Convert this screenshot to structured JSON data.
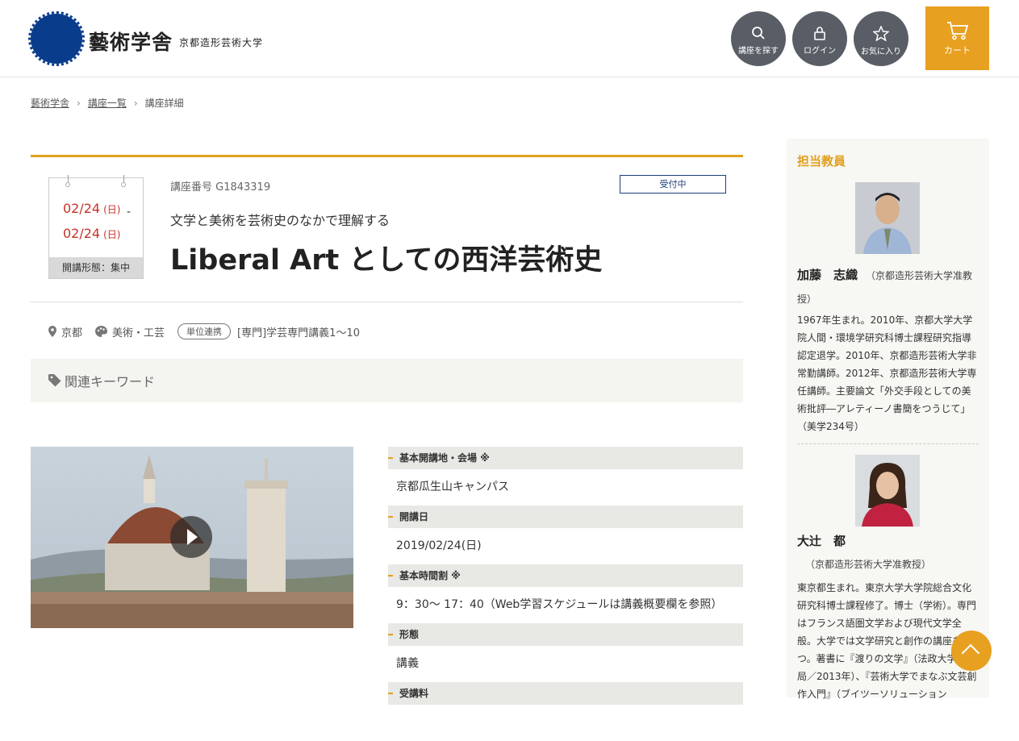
{
  "header": {
    "logo_text": "藝術学舎",
    "logo_sub": "京都造形芸術大学",
    "search_label": "講座を探す",
    "login_label": "ログイン",
    "favorites_label": "お気に入り",
    "cart_label": "カート"
  },
  "breadcrumb": [
    "藝術学舎",
    "講座一覧",
    "講座詳細"
  ],
  "course": {
    "date_start": "02/24",
    "date_start_day": "(日)",
    "date_end": "02/24",
    "date_end_day": "(日)",
    "format": "開講形態：集中",
    "number": "講座番号 G1843319",
    "status": "受付中",
    "subtitle": "文学と美術を芸術史のなかで理解する",
    "title": "Liberal Art としての西洋芸術史",
    "location": "京都",
    "category": "美術・工芸",
    "credit_badge": "単位連携",
    "credit_text": "[専門]学芸専門講義1〜10",
    "keywords_label": "関連キーワード"
  },
  "info": [
    {
      "label": "基本開講地・会場 ※",
      "value": "京都瓜生山キャンパス"
    },
    {
      "label": "開講日",
      "value": "2019/02/24(日)"
    },
    {
      "label": "基本時間割 ※",
      "value": "9：30〜 17：40（Web学習スケジュールは講義概要欄を参照）"
    },
    {
      "label": "形態",
      "value": "講義"
    },
    {
      "label": "受講料",
      "value": ""
    }
  ],
  "sidebar": {
    "heading": "担当教員",
    "teachers": [
      {
        "name": "加藤　志織",
        "affil": "（京都造形芸術大学准教授）",
        "bio": "1967年生まれ。2010年、京都大学大学院人間・環境学研究科博士課程研究指導認定退学。2010年、京都造形芸術大学非常勤講師。2012年、京都造形芸術大学専任講師。主要論文「外交手段としての美術批評―アレティーノ書簡をつうじて」（美学234号）"
      },
      {
        "name": "大辻　都",
        "affil": "（京都造形芸術大学准教授）",
        "bio": "東京都生まれ。東京大学大学院総合文化研究科博士課程修了。博士（学術）。専門はフランス語圏文学および現代文学全般。大学では文学研究と創作の講座を持つ。著書に『渡りの文学』（法政大学出版局／2013年）、『芸術大学でまなぶ文芸創作入門』（ブイツーソリューション"
      }
    ]
  },
  "colors": {
    "accent": "#e0a020",
    "brand": "#0a3c8c",
    "status": "#1f3e7a",
    "date": "#c8322a"
  }
}
